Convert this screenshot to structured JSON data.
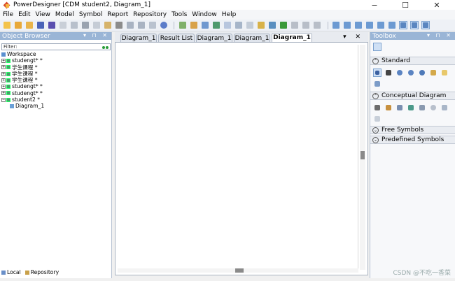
{
  "window": {
    "title": "PowerDesigner [CDM student2, Diagram_1]",
    "controls": {
      "minimize": "−",
      "maximize": "☐",
      "close": "✕"
    }
  },
  "menu": [
    "File",
    "Edit",
    "View",
    "Model",
    "Symbol",
    "Report",
    "Repository",
    "Tools",
    "Window",
    "Help"
  ],
  "object_browser": {
    "title": "Object Browser",
    "header_controls": "▾ ⊓ ✕",
    "filter_label": "Filter:",
    "tree": [
      {
        "label": "Workspace",
        "expander": "",
        "indent": 0,
        "icon": "workspace-icon"
      },
      {
        "label": "studengt* *",
        "expander": "+",
        "indent": 0,
        "icon": "model-icon"
      },
      {
        "label": "学生课程 *",
        "expander": "+",
        "indent": 0,
        "icon": "model-icon"
      },
      {
        "label": "学生课程 *",
        "expander": "+",
        "indent": 0,
        "icon": "model-icon"
      },
      {
        "label": "学生课程 *",
        "expander": "+",
        "indent": 0,
        "icon": "model-icon"
      },
      {
        "label": "studengt* *",
        "expander": "+",
        "indent": 0,
        "icon": "model-icon"
      },
      {
        "label": "studengt* *",
        "expander": "+",
        "indent": 0,
        "icon": "model-icon"
      },
      {
        "label": "student2 *",
        "expander": "−",
        "indent": 0,
        "icon": "model-icon"
      },
      {
        "label": "Diagram_1",
        "expander": "",
        "indent": 1,
        "icon": "diagram-icon"
      }
    ],
    "bottom_tabs": [
      "Local",
      "Repository"
    ]
  },
  "document_tabs": {
    "tabs": [
      "Diagram_1",
      "Result List",
      "Diagram_1",
      "Diagram_1",
      "Diagram_1"
    ],
    "active_index": 4,
    "controls": "▾ ✕"
  },
  "toolbox": {
    "title": "Toolbox",
    "header_controls": "▾ ⊓ ✕",
    "sections": [
      {
        "label": "Standard",
        "expanded": true,
        "chevron": "⌃"
      },
      {
        "label": "Conceptual Diagram",
        "expanded": true,
        "chevron": "⌃"
      },
      {
        "label": "Free Symbols",
        "expanded": false,
        "chevron": "⌄"
      },
      {
        "label": "Predefined Symbols",
        "expanded": false,
        "chevron": "⌄"
      }
    ],
    "standard_tools": [
      "pointer-icon",
      "grabber-icon",
      "zoom-in-icon",
      "zoom-out-icon",
      "open-package-icon",
      "properties-icon",
      "note-icon",
      "link-icon"
    ],
    "conceptual_tools": [
      "delete-icon",
      "entity-icon",
      "inheritance-icon",
      "relationship-icon",
      "association-icon",
      "association-link-icon",
      "package-icon",
      "file-icon"
    ]
  },
  "watermark": "CSDN @不吃一香菜",
  "colors": {
    "panel_header": "#9ab5d6",
    "toolbar_bg": "#eef1f6",
    "selection": "#cfe0f5"
  }
}
